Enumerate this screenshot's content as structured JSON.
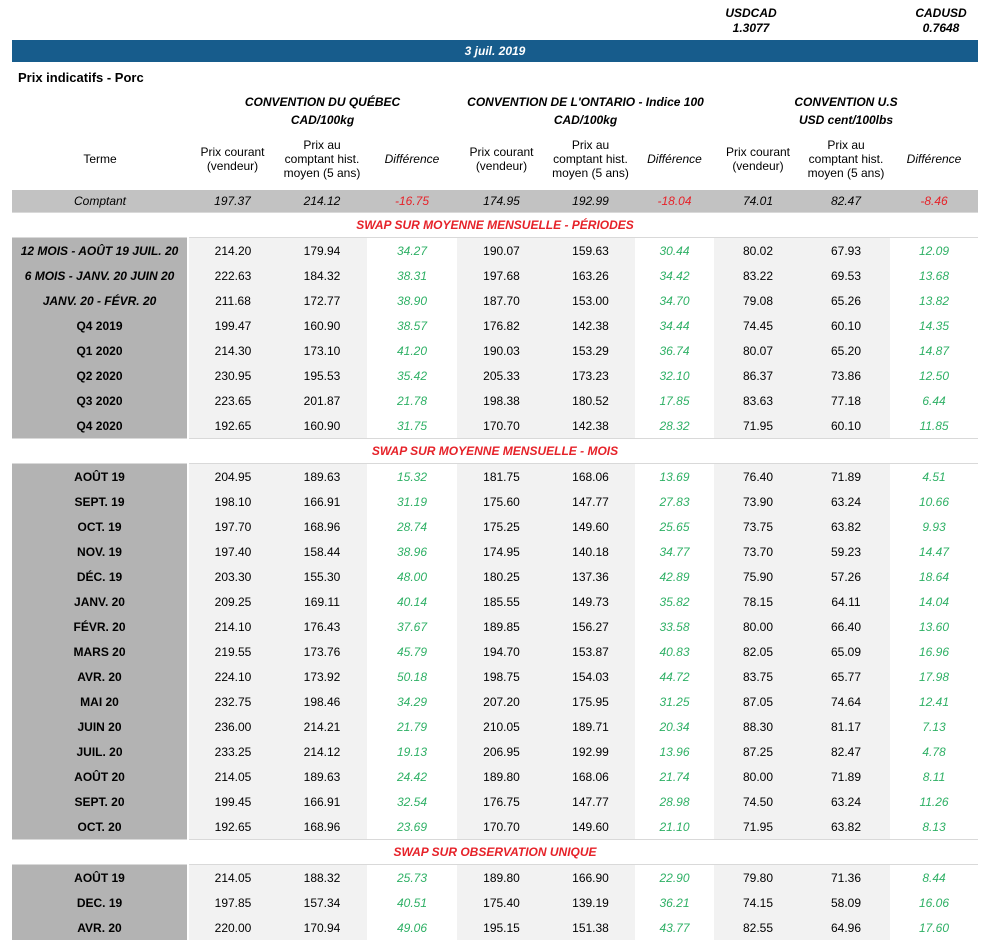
{
  "fx": {
    "usdcad_label": "USDCAD",
    "usdcad_value": "1.3077",
    "cadusd_label": "CADUSD",
    "cadusd_value": "0.7648"
  },
  "date_banner": "3 juil. 2019",
  "page_title": "Prix indicatifs - Porc",
  "colors": {
    "banner_blue": "#175c8c",
    "section_red": "#e62229",
    "positive_green": "#2eb065",
    "terme_gray": "#b3b3b3",
    "comptant_gray": "#c2c2c2",
    "value_block_gray": "#f2f2f2"
  },
  "conventions": [
    {
      "title": "CONVENTION DU QUÉBEC",
      "unit": "CAD/100kg"
    },
    {
      "title": "CONVENTION DE L'ONTARIO - Indice 100",
      "unit": "CAD/100kg"
    },
    {
      "title": "CONVENTION U.S",
      "unit": "USD cent/100lbs"
    }
  ],
  "columns": {
    "terme": "Terme",
    "prix_courant": "Prix courant (vendeur)",
    "prix_comptant": "Prix au comptant hist. moyen (5 ans)",
    "difference": "Différence"
  },
  "comptant": {
    "label": "Comptant",
    "values": [
      "197.37",
      "214.12",
      "-16.75",
      "174.95",
      "192.99",
      "-18.04",
      "74.01",
      "82.47",
      "-8.46"
    ]
  },
  "sections": [
    {
      "title": "SWAP SUR MOYENNE MENSUELLE - PÉRIODES",
      "rows": [
        {
          "terme": "12 MOIS -  AOÛT 19 JUIL. 20",
          "i": true,
          "values": [
            "214.20",
            "179.94",
            "34.27",
            "190.07",
            "159.63",
            "30.44",
            "80.02",
            "67.93",
            "12.09"
          ]
        },
        {
          "terme": "6 MOIS -  JANV. 20 JUIN 20",
          "i": true,
          "values": [
            "222.63",
            "184.32",
            "38.31",
            "197.68",
            "163.26",
            "34.42",
            "83.22",
            "69.53",
            "13.68"
          ]
        },
        {
          "terme": "JANV. 20 -  FÉVR. 20",
          "i": true,
          "values": [
            "211.68",
            "172.77",
            "38.90",
            "187.70",
            "153.00",
            "34.70",
            "79.08",
            "65.26",
            "13.82"
          ]
        },
        {
          "terme": "Q4 2019",
          "values": [
            "199.47",
            "160.90",
            "38.57",
            "176.82",
            "142.38",
            "34.44",
            "74.45",
            "60.10",
            "14.35"
          ]
        },
        {
          "terme": "Q1 2020",
          "values": [
            "214.30",
            "173.10",
            "41.20",
            "190.03",
            "153.29",
            "36.74",
            "80.07",
            "65.20",
            "14.87"
          ]
        },
        {
          "terme": "Q2 2020",
          "values": [
            "230.95",
            "195.53",
            "35.42",
            "205.33",
            "173.23",
            "32.10",
            "86.37",
            "73.86",
            "12.50"
          ]
        },
        {
          "terme": "Q3 2020",
          "values": [
            "223.65",
            "201.87",
            "21.78",
            "198.38",
            "180.52",
            "17.85",
            "83.63",
            "77.18",
            "6.44"
          ]
        },
        {
          "terme": "Q4 2020",
          "values": [
            "192.65",
            "160.90",
            "31.75",
            "170.70",
            "142.38",
            "28.32",
            "71.95",
            "60.10",
            "11.85"
          ]
        }
      ]
    },
    {
      "title": "SWAP SUR MOYENNE MENSUELLE - MOIS",
      "rows": [
        {
          "terme": "AOÛT 19",
          "values": [
            "204.95",
            "189.63",
            "15.32",
            "181.75",
            "168.06",
            "13.69",
            "76.40",
            "71.89",
            "4.51"
          ]
        },
        {
          "terme": "SEPT. 19",
          "values": [
            "198.10",
            "166.91",
            "31.19",
            "175.60",
            "147.77",
            "27.83",
            "73.90",
            "63.24",
            "10.66"
          ]
        },
        {
          "terme": "OCT. 19",
          "values": [
            "197.70",
            "168.96",
            "28.74",
            "175.25",
            "149.60",
            "25.65",
            "73.75",
            "63.82",
            "9.93"
          ]
        },
        {
          "terme": "NOV. 19",
          "values": [
            "197.40",
            "158.44",
            "38.96",
            "174.95",
            "140.18",
            "34.77",
            "73.70",
            "59.23",
            "14.47"
          ]
        },
        {
          "terme": "DÉC. 19",
          "values": [
            "203.30",
            "155.30",
            "48.00",
            "180.25",
            "137.36",
            "42.89",
            "75.90",
            "57.26",
            "18.64"
          ]
        },
        {
          "terme": "JANV. 20",
          "values": [
            "209.25",
            "169.11",
            "40.14",
            "185.55",
            "149.73",
            "35.82",
            "78.15",
            "64.11",
            "14.04"
          ]
        },
        {
          "terme": "FÉVR. 20",
          "values": [
            "214.10",
            "176.43",
            "37.67",
            "189.85",
            "156.27",
            "33.58",
            "80.00",
            "66.40",
            "13.60"
          ]
        },
        {
          "terme": "MARS 20",
          "values": [
            "219.55",
            "173.76",
            "45.79",
            "194.70",
            "153.87",
            "40.83",
            "82.05",
            "65.09",
            "16.96"
          ]
        },
        {
          "terme": "AVR. 20",
          "values": [
            "224.10",
            "173.92",
            "50.18",
            "198.75",
            "154.03",
            "44.72",
            "83.75",
            "65.77",
            "17.98"
          ]
        },
        {
          "terme": "MAI 20",
          "values": [
            "232.75",
            "198.46",
            "34.29",
            "207.20",
            "175.95",
            "31.25",
            "87.05",
            "74.64",
            "12.41"
          ]
        },
        {
          "terme": "JUIN 20",
          "values": [
            "236.00",
            "214.21",
            "21.79",
            "210.05",
            "189.71",
            "20.34",
            "88.30",
            "81.17",
            "7.13"
          ]
        },
        {
          "terme": "JUIL. 20",
          "values": [
            "233.25",
            "214.12",
            "19.13",
            "206.95",
            "192.99",
            "13.96",
            "87.25",
            "82.47",
            "4.78"
          ]
        },
        {
          "terme": "AOÛT 20",
          "values": [
            "214.05",
            "189.63",
            "24.42",
            "189.80",
            "168.06",
            "21.74",
            "80.00",
            "71.89",
            "8.11"
          ]
        },
        {
          "terme": "SEPT. 20",
          "values": [
            "199.45",
            "166.91",
            "32.54",
            "176.75",
            "147.77",
            "28.98",
            "74.50",
            "63.24",
            "11.26"
          ]
        },
        {
          "terme": "OCT. 20",
          "values": [
            "192.65",
            "168.96",
            "23.69",
            "170.70",
            "149.60",
            "21.10",
            "71.95",
            "63.82",
            "8.13"
          ]
        }
      ]
    },
    {
      "title": "SWAP SUR OBSERVATION UNIQUE",
      "rows": [
        {
          "terme": "AOÛT 19",
          "values": [
            "214.05",
            "188.32",
            "25.73",
            "189.80",
            "166.90",
            "22.90",
            "79.80",
            "71.36",
            "8.44"
          ]
        },
        {
          "terme": "DEC. 19",
          "values": [
            "197.85",
            "157.34",
            "40.51",
            "175.40",
            "139.19",
            "36.21",
            "74.15",
            "58.09",
            "16.06"
          ]
        },
        {
          "terme": "AVR. 20",
          "values": [
            "220.00",
            "170.94",
            "49.06",
            "195.15",
            "151.38",
            "43.77",
            "82.55",
            "64.96",
            "17.60"
          ]
        }
      ]
    }
  ]
}
